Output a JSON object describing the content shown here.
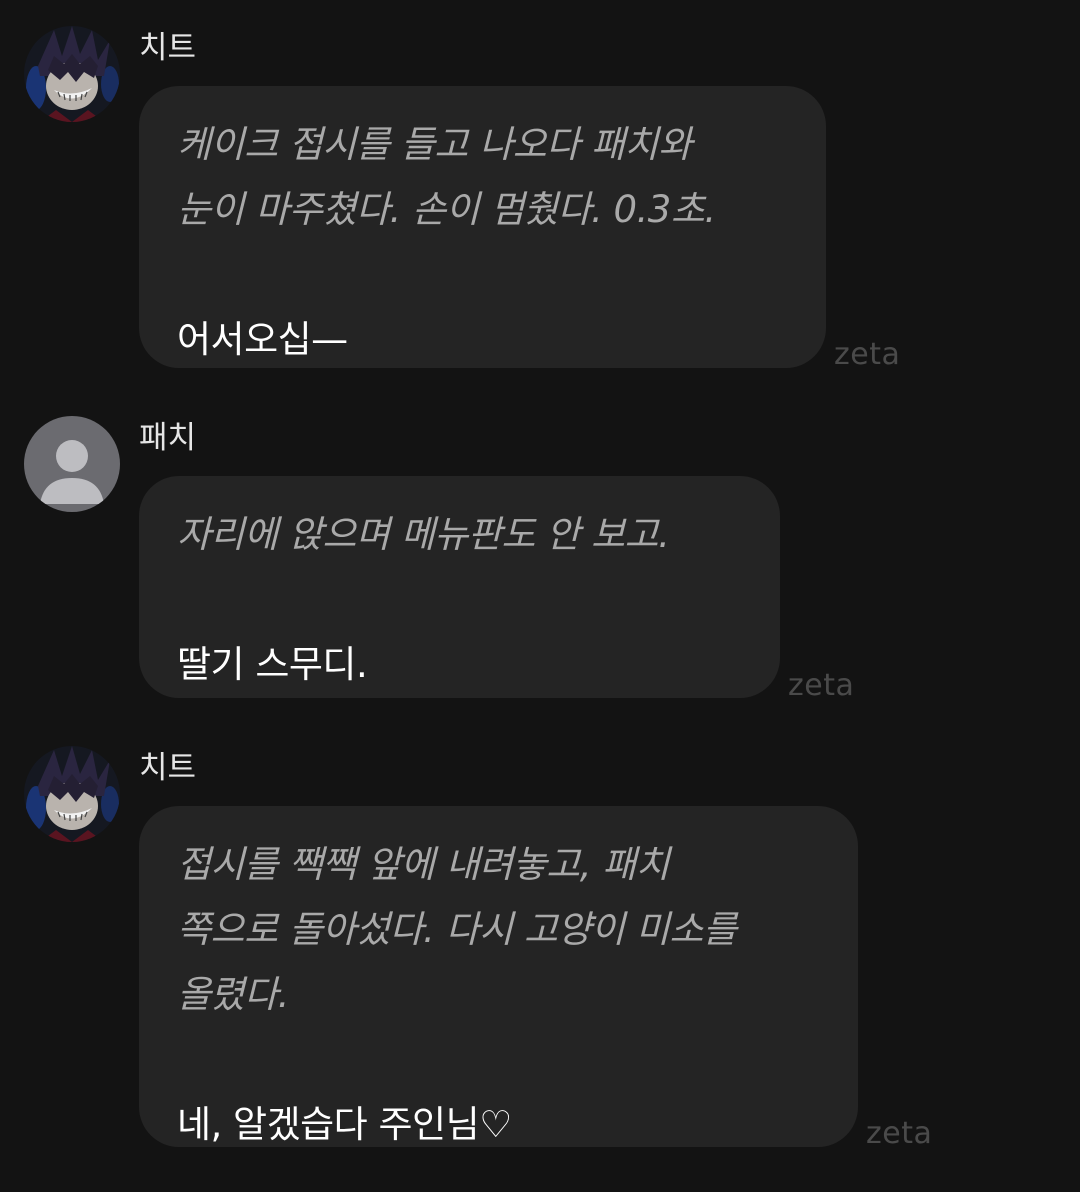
{
  "messages": [
    {
      "sender": "치트",
      "narration_lines": [
        "케이크 접시를 들고 나오다 패치와",
        "눈이 마주쳤다. 손이 멈췄다. 0.3초."
      ],
      "speech": "어서오십—",
      "watermark": "zeta"
    },
    {
      "sender": "패치",
      "narration_lines": [
        "자리에 앉으며 메뉴판도 안 보고."
      ],
      "speech": "딸기 스무디.",
      "watermark": "zeta"
    },
    {
      "sender": "치트",
      "narration_lines": [
        "접시를 짹짹 앞에 내려놓고, 패치",
        "쪽으로 돌아섰다. 다시 고양이 미소를",
        "올렸다."
      ],
      "speech": "네, 알겠습다 주인님♡",
      "watermark": "zeta"
    }
  ],
  "colors": {
    "background": "#131313",
    "bubble": "#242424",
    "narration_text": "#a9a9a9",
    "speech_text": "#ffffff",
    "watermark": "#4a4a4a"
  },
  "icons": {
    "character_avatar": "character-portrait-icon",
    "user_avatar": "default-user-icon"
  }
}
